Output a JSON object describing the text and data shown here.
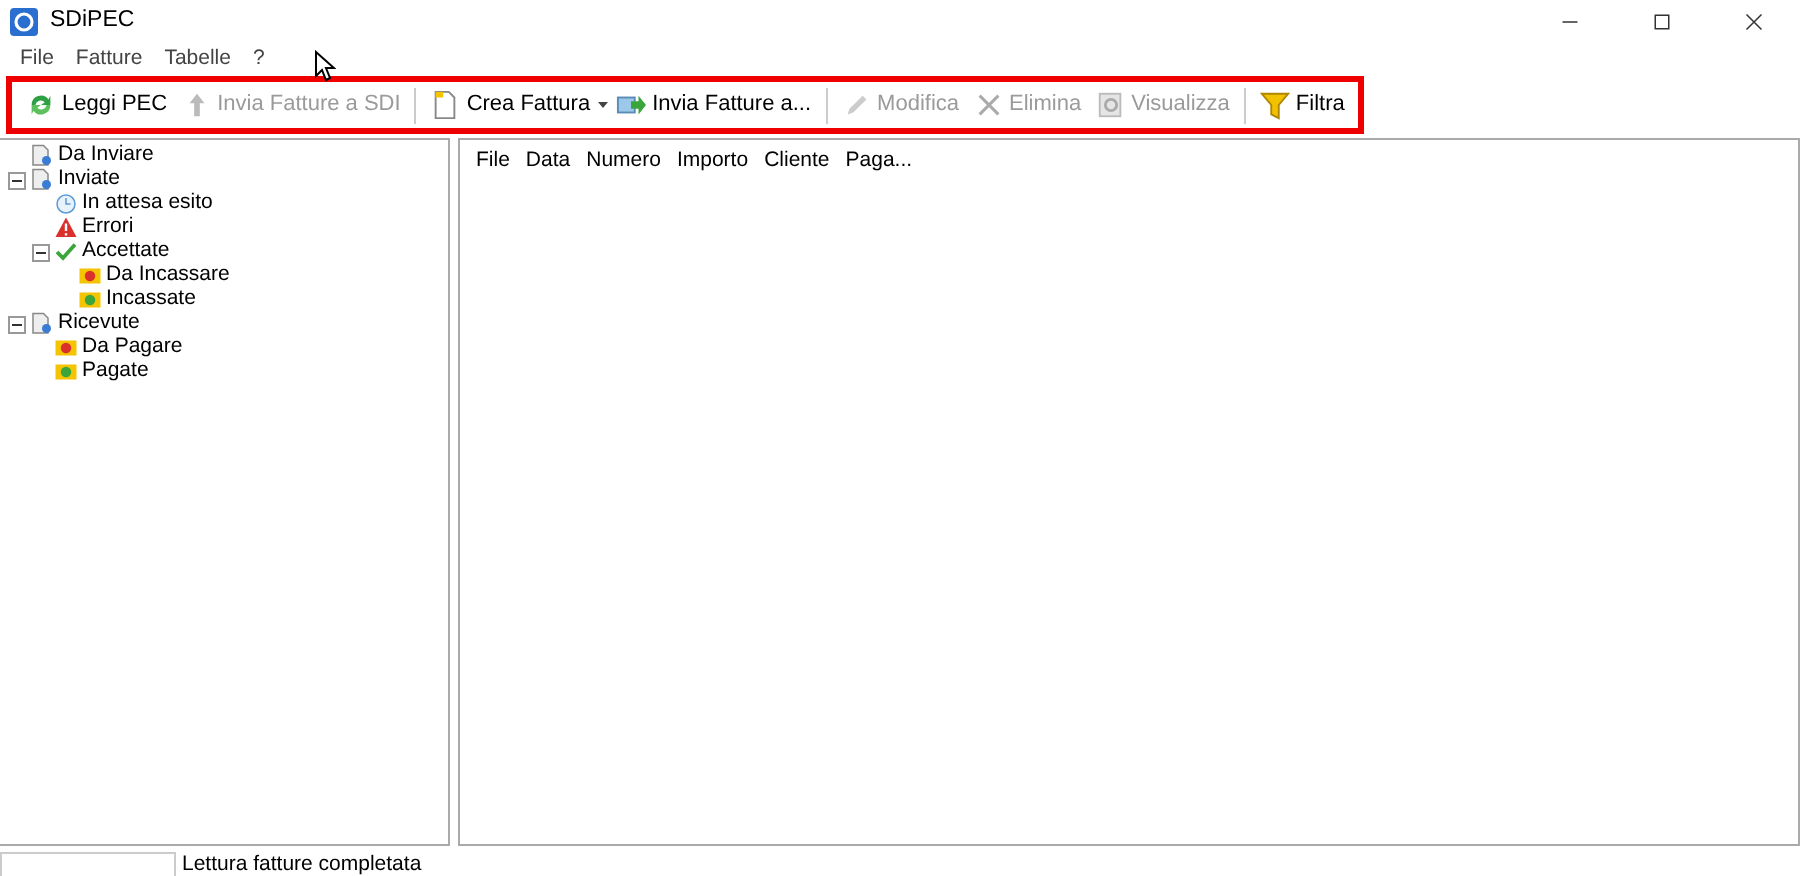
{
  "window": {
    "title": "SDiPEC"
  },
  "menu": [
    "File",
    "Fatture",
    "Tabelle",
    "?"
  ],
  "toolbar": [
    {
      "label": "Leggi PEC",
      "kind": "refresh",
      "disabled": false,
      "dropdown": false
    },
    {
      "label": "Invia Fatture a SDI",
      "kind": "up",
      "disabled": true,
      "dropdown": false
    },
    {
      "kind": "separator"
    },
    {
      "label": "Crea Fattura",
      "kind": "page",
      "disabled": false,
      "dropdown": true
    },
    {
      "label": "Invia Fatture a...",
      "kind": "send",
      "disabled": false,
      "dropdown": false
    },
    {
      "kind": "separator"
    },
    {
      "label": "Modifica",
      "kind": "pencil",
      "disabled": true,
      "dropdown": false
    },
    {
      "label": "Elimina",
      "kind": "cross",
      "disabled": true,
      "dropdown": false
    },
    {
      "label": "Visualizza",
      "kind": "view",
      "disabled": true,
      "dropdown": false
    },
    {
      "kind": "separator"
    },
    {
      "label": "Filtra",
      "kind": "funnel",
      "disabled": false,
      "dropdown": false
    }
  ],
  "tree": [
    {
      "label": "Da Inviare",
      "kind": "doc"
    },
    {
      "label": "Inviate",
      "kind": "doc",
      "expanded": true,
      "children": [
        {
          "label": "In attesa esito",
          "kind": "clock"
        },
        {
          "label": "Errori",
          "kind": "warning"
        },
        {
          "label": "Accettate",
          "kind": "check",
          "expanded": true,
          "children": [
            {
              "label": "Da Incassare",
              "kind": "money-red"
            },
            {
              "label": "Incassate",
              "kind": "money-green"
            }
          ]
        }
      ]
    },
    {
      "label": "Ricevute",
      "kind": "doc",
      "expanded": true,
      "children": [
        {
          "label": "Da Pagare",
          "kind": "money-red"
        },
        {
          "label": "Pagate",
          "kind": "money-green"
        }
      ]
    }
  ],
  "table": {
    "columns": [
      "File",
      "Data",
      "Numero",
      "Importo",
      "Cliente",
      "Paga..."
    ]
  },
  "status_bar": {
    "message": "Lettura fatture completata"
  }
}
